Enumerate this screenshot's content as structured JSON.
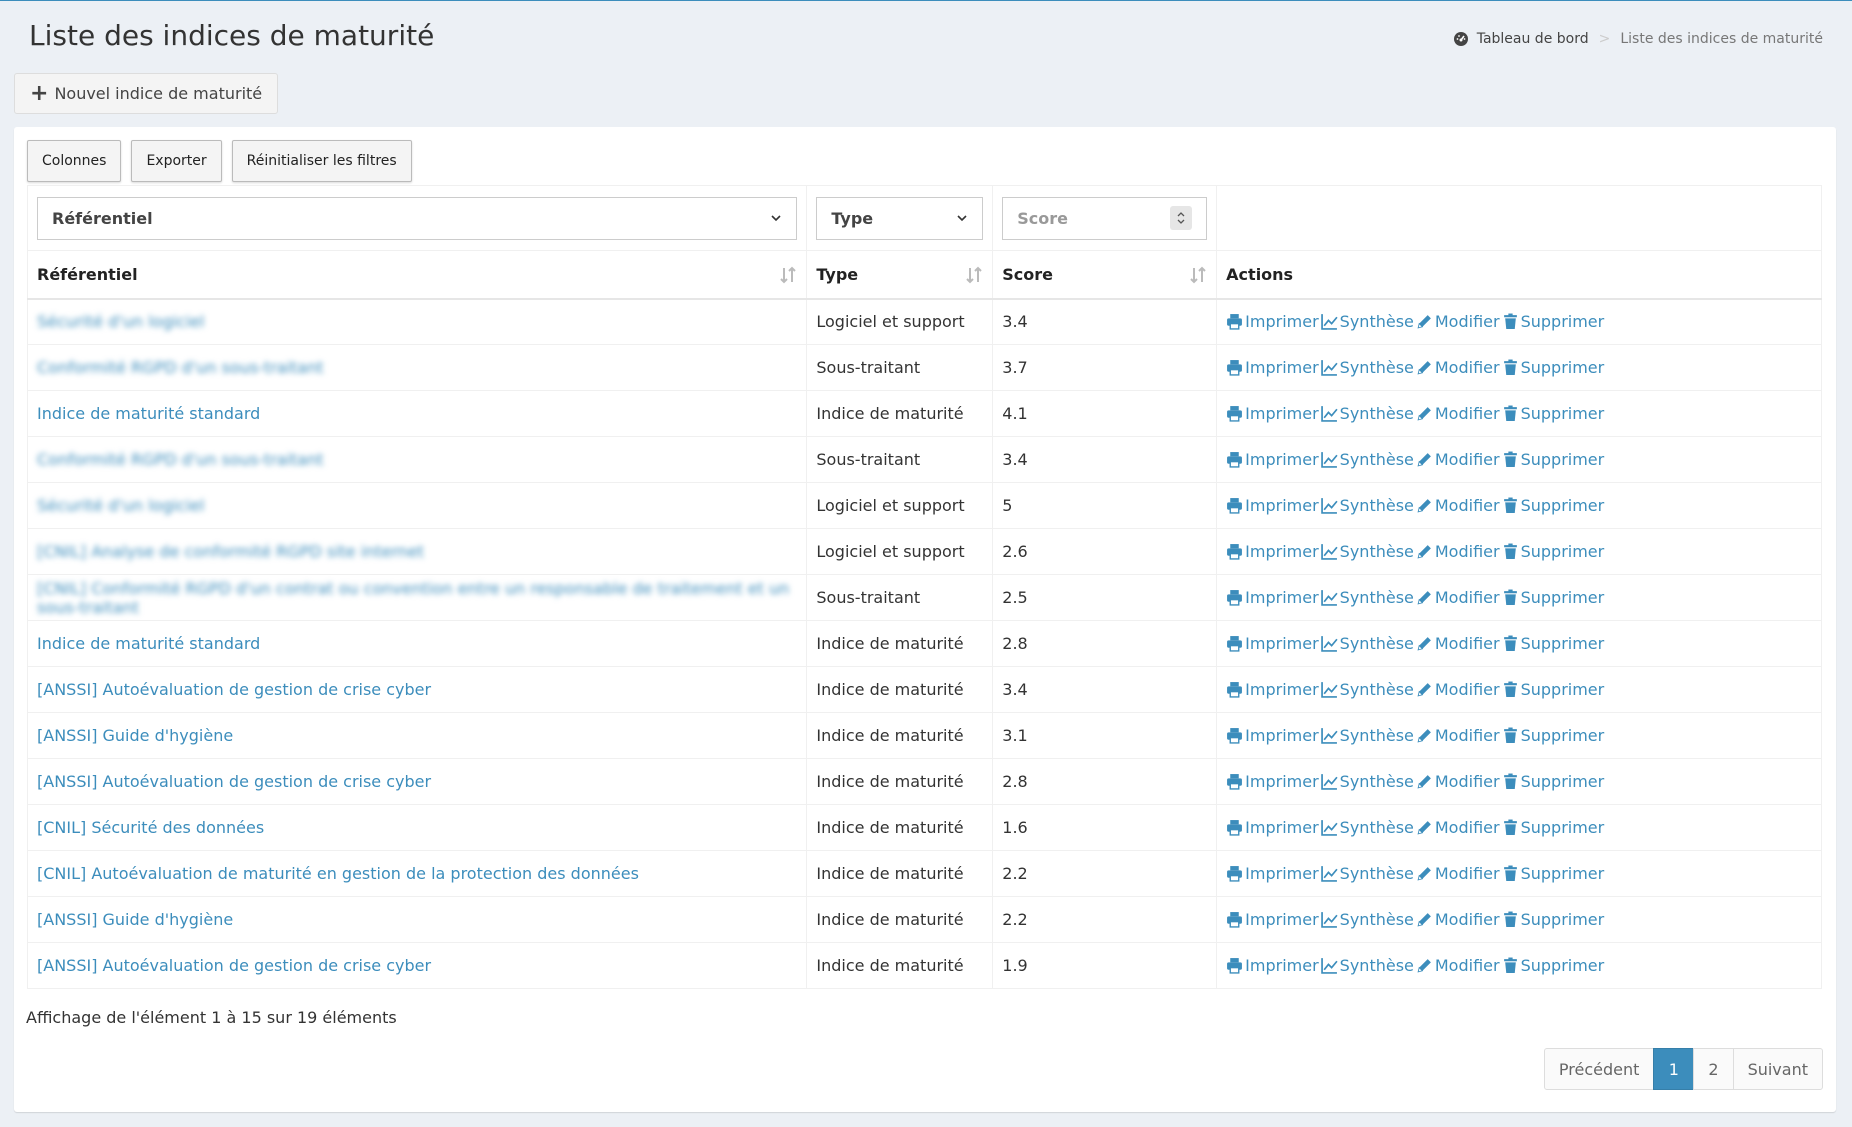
{
  "page": {
    "title": "Liste des indices de maturité",
    "new_button": "Nouvel indice de maturité"
  },
  "breadcrumb": {
    "home": "Tableau de bord",
    "separator": ">",
    "current": "Liste des indices de maturité"
  },
  "toolbar": {
    "columns": "Colonnes",
    "export": "Exporter",
    "reset": "Réinitialiser les filtres"
  },
  "filters": {
    "referentiel": "Référentiel",
    "type": "Type",
    "score_placeholder": "Score"
  },
  "table": {
    "headers": [
      "Référentiel",
      "Type",
      "Score",
      "Actions"
    ],
    "actions": [
      "Imprimer",
      "Synthèse",
      "Modifier",
      "Supprimer"
    ],
    "rows": [
      {
        "ref": "Sécurité d'un logiciel",
        "blurred": true,
        "type": "Logiciel et support",
        "score": "3.4"
      },
      {
        "ref": "Conformité RGPD d'un sous-traitant",
        "blurred": true,
        "type": "Sous-traitant",
        "score": "3.7"
      },
      {
        "ref": "Indice de maturité standard",
        "blurred": false,
        "type": "Indice de maturité",
        "score": "4.1"
      },
      {
        "ref": "Conformité RGPD d'un sous-traitant",
        "blurred": true,
        "type": "Sous-traitant",
        "score": "3.4"
      },
      {
        "ref": "Sécurité d'un logiciel",
        "blurred": true,
        "type": "Logiciel et support",
        "score": "5"
      },
      {
        "ref": "[CNIL] Analyse de conformité RGPD site internet",
        "blurred": true,
        "type": "Logiciel et support",
        "score": "2.6"
      },
      {
        "ref": "[CNIL] Conformité RGPD d'un contrat ou convention entre un responsable de traitement et un sous-traitant",
        "blurred": true,
        "type": "Sous-traitant",
        "score": "2.5"
      },
      {
        "ref": "Indice de maturité standard",
        "blurred": false,
        "type": "Indice de maturité",
        "score": "2.8"
      },
      {
        "ref": "[ANSSI] Autoévaluation de gestion de crise cyber",
        "blurred": false,
        "type": "Indice de maturité",
        "score": "3.4"
      },
      {
        "ref": "[ANSSI] Guide d'hygiène",
        "blurred": false,
        "type": "Indice de maturité",
        "score": "3.1"
      },
      {
        "ref": "[ANSSI] Autoévaluation de gestion de crise cyber",
        "blurred": false,
        "type": "Indice de maturité",
        "score": "2.8"
      },
      {
        "ref": "[CNIL] Sécurité des données",
        "blurred": false,
        "type": "Indice de maturité",
        "score": "1.6"
      },
      {
        "ref": "[CNIL] Autoévaluation de maturité en gestion de la protection des données",
        "blurred": false,
        "type": "Indice de maturité",
        "score": "2.2"
      },
      {
        "ref": "[ANSSI] Guide d'hygiène",
        "blurred": false,
        "type": "Indice de maturité",
        "score": "2.2"
      },
      {
        "ref": "[ANSSI] Autoévaluation de gestion de crise cyber",
        "blurred": false,
        "type": "Indice de maturité",
        "score": "1.9"
      }
    ]
  },
  "footer": {
    "info": "Affichage de l'élément 1 à 15 sur 19 éléments"
  },
  "pagination": {
    "prev": "Précédent",
    "pages": [
      "1",
      "2"
    ],
    "active": "1",
    "next": "Suivant"
  },
  "colors": {
    "accent": "#3c8dbc",
    "background": "#ecf0f5"
  }
}
